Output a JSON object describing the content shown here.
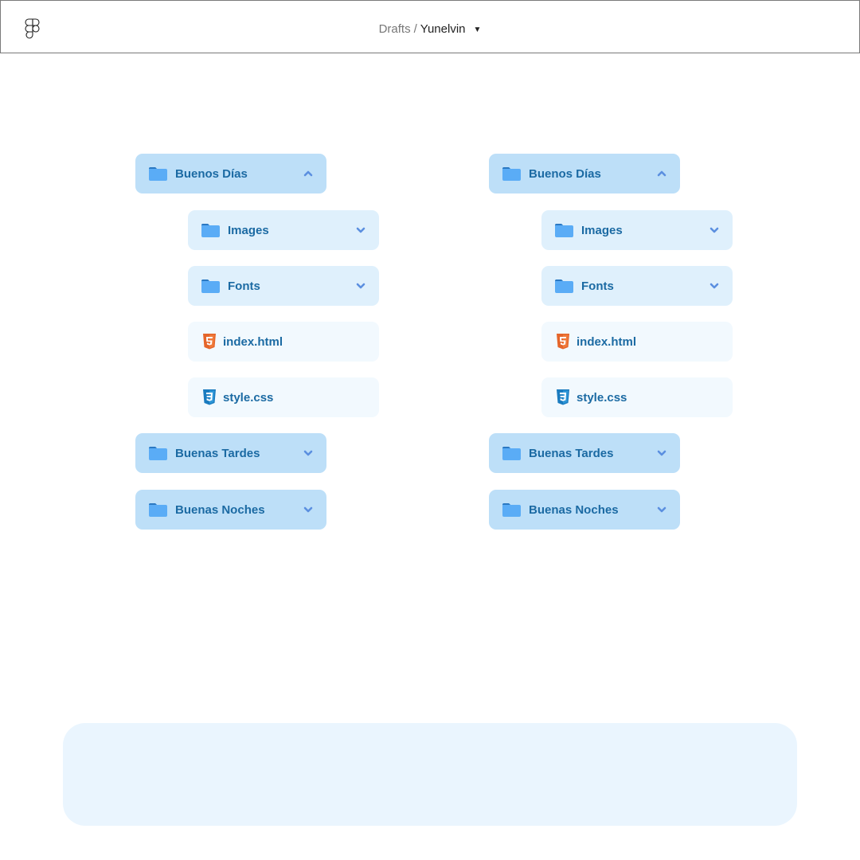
{
  "header": {
    "logo_icon": "figma-logo-icon",
    "breadcrumb": {
      "parent": "Drafts",
      "separator": "/",
      "current": "Yunelvin",
      "dropdown_icon": "caret-down-icon"
    }
  },
  "colors": {
    "folder_row": "#bddff8",
    "subfolder_row": "#dff0fc",
    "file_row": "#f2f9fe",
    "label_text": "#1b6aa3",
    "folder_icon": "#5aacf6",
    "chevron": "#5b8fe0",
    "html_icon": "#e5652a",
    "css_icon": "#1a7bbf",
    "panel": "#eaf5fe"
  },
  "trees": [
    {
      "items": [
        {
          "type": "folder",
          "label": "Buenos Días",
          "expanded": true,
          "icon": "folder-icon",
          "chevron": "chevron-up-icon"
        },
        {
          "type": "subfolder",
          "label": "Images",
          "expanded": false,
          "icon": "folder-icon",
          "chevron": "chevron-down-icon"
        },
        {
          "type": "subfolder",
          "label": "Fonts",
          "expanded": false,
          "icon": "folder-icon",
          "chevron": "chevron-down-icon"
        },
        {
          "type": "file",
          "label": "index.html",
          "icon": "html5-icon"
        },
        {
          "type": "file",
          "label": "style.css",
          "icon": "css3-icon"
        },
        {
          "type": "folder",
          "label": "Buenas Tardes",
          "expanded": false,
          "icon": "folder-icon",
          "chevron": "chevron-down-icon"
        },
        {
          "type": "folder",
          "label": "Buenas Noches",
          "expanded": false,
          "icon": "folder-icon",
          "chevron": "chevron-down-icon"
        }
      ]
    },
    {
      "items": [
        {
          "type": "folder",
          "label": "Buenos Días",
          "expanded": true,
          "icon": "folder-icon",
          "chevron": "chevron-up-icon"
        },
        {
          "type": "subfolder",
          "label": "Images",
          "expanded": false,
          "icon": "folder-icon",
          "chevron": "chevron-down-icon"
        },
        {
          "type": "subfolder",
          "label": "Fonts",
          "expanded": false,
          "icon": "folder-icon",
          "chevron": "chevron-down-icon"
        },
        {
          "type": "file",
          "label": "index.html",
          "icon": "html5-icon"
        },
        {
          "type": "file",
          "label": "style.css",
          "icon": "css3-icon"
        },
        {
          "type": "folder",
          "label": "Buenas Tardes",
          "expanded": false,
          "icon": "folder-icon",
          "chevron": "chevron-down-icon"
        },
        {
          "type": "folder",
          "label": "Buenas Noches",
          "expanded": false,
          "icon": "folder-icon",
          "chevron": "chevron-down-icon"
        }
      ]
    }
  ]
}
